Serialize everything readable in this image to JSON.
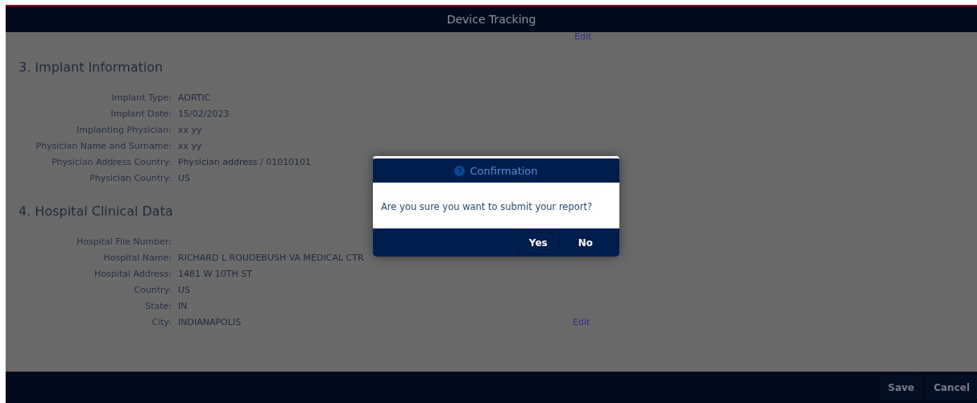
{
  "header": {
    "title": "Device Tracking"
  },
  "top_link": "Edit",
  "sections": [
    {
      "title": "3. Implant Information",
      "fields": [
        {
          "label": "Implant Type:",
          "value": "AORTIC"
        },
        {
          "label": "Implant Date:",
          "value": "15/02/2023"
        },
        {
          "label": "Implanting Physician:",
          "value": "xx yy"
        },
        {
          "label": "Physician Name and Surname:",
          "value": "xx yy"
        },
        {
          "label": "Physician Address Country:",
          "value": "Physician address / 01010101"
        },
        {
          "label": "Physician Country:",
          "value": "US"
        }
      ]
    },
    {
      "title": "4. Hospital Clinical Data",
      "fields": [
        {
          "label": "Hospital File Number:"
        },
        {
          "label": "Hospital Name:",
          "value": "RICHARD L ROUDEBUSH VA MEDICAL CTR"
        },
        {
          "label": "Hospital Address:",
          "value": "1481 W 10TH ST"
        },
        {
          "label": "Country:",
          "value": "US"
        },
        {
          "label": "State:",
          "value": "IN"
        },
        {
          "label": "City:",
          "value": "INDIANAPOLIS",
          "link": "Edit"
        }
      ]
    }
  ],
  "footer": {
    "buttons": [
      {
        "label": "Save"
      },
      {
        "label": "Cancel"
      }
    ]
  },
  "dialog": {
    "title": "Confirmation",
    "message": "Are you sure you want to submit your report?",
    "buttons": [
      {
        "label": "Yes",
        "selected": true
      },
      {
        "label": "No",
        "selected": false
      }
    ]
  }
}
